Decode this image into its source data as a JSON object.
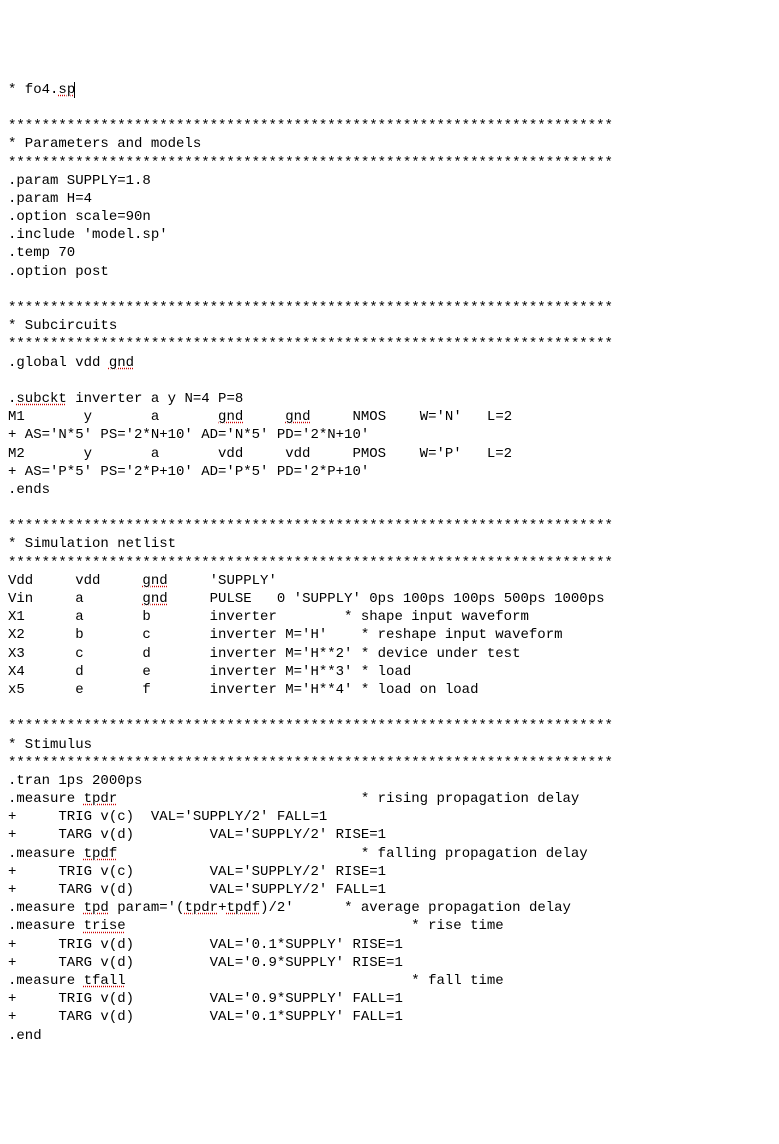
{
  "lines": {
    "l01a": "* fo4.",
    "l01b": "sp",
    "l02": "",
    "l03": "************************************************************************",
    "l04": "* Parameters and models",
    "l05": "************************************************************************",
    "l06": ".param SUPPLY=1.8",
    "l07": ".param H=4",
    "l08": ".option scale=90n",
    "l09": ".include 'model.sp'",
    "l10": ".temp 70",
    "l11": ".option post",
    "l12": "",
    "l13": "************************************************************************",
    "l14": "* Subcircuits",
    "l15": "************************************************************************",
    "l16a": ".global vdd ",
    "l16b": "gnd",
    "l17": "",
    "l18a": ".",
    "l18b": "subckt",
    "l18c": " inverter a y N=4 P=8",
    "l19a": "M1       y       a       ",
    "l19b": "gnd",
    "l19c": "     ",
    "l19d": "gnd",
    "l19e": "     NMOS    W='N'   L=2",
    "l20": "+ AS='N*5' PS='2*N+10' AD='N*5' PD='2*N+10'",
    "l21": "M2       y       a       vdd     vdd     PMOS    W='P'   L=2",
    "l22": "+ AS='P*5' PS='2*P+10' AD='P*5' PD='2*P+10'",
    "l23": ".ends",
    "l24": "",
    "l25": "************************************************************************",
    "l26": "* Simulation netlist",
    "l27": "************************************************************************",
    "l28a": "Vdd     vdd     ",
    "l28b": "gnd",
    "l28c": "     'SUPPLY'",
    "l29a": "Vin     a       ",
    "l29b": "gnd",
    "l29c": "     PULSE   0 'SUPPLY' 0ps 100ps 100ps 500ps 1000ps",
    "l30": "X1      a       b       inverter        * shape input waveform",
    "l31": "X2      b       c       inverter M='H'    * reshape input waveform",
    "l32": "X3      c       d       inverter M='H**2' * device under test",
    "l33": "X4      d       e       inverter M='H**3' * load",
    "l34": "x5      e       f       inverter M='H**4' * load on load",
    "l35": "",
    "l36": "************************************************************************",
    "l37": "* Stimulus",
    "l38": "************************************************************************",
    "l39": ".tran 1ps 2000ps",
    "l40a": ".measure ",
    "l40b": "tpdr",
    "l40c": "                             * rising propagation delay",
    "l41": "+     TRIG v(c)  VAL='SUPPLY/2' FALL=1",
    "l42": "+     TARG v(d)         VAL='SUPPLY/2' RISE=1",
    "l43a": ".measure ",
    "l43b": "tpdf",
    "l43c": "                             * falling propagation delay",
    "l44": "+     TRIG v(c)         VAL='SUPPLY/2' RISE=1",
    "l45": "+     TARG v(d)         VAL='SUPPLY/2' FALL=1",
    "l46a": ".measure ",
    "l46b": "tpd",
    "l46c": " param='(",
    "l46d": "tpdr",
    "l46e": "+",
    "l46f": "tpdf",
    "l46g": ")/2'      * average propagation delay",
    "l47a": ".measure ",
    "l47b": "trise",
    "l47c": "                                  * rise time",
    "l48": "+     TRIG v(d)         VAL='0.1*SUPPLY' RISE=1",
    "l49": "+     TARG v(d)         VAL='0.9*SUPPLY' RISE=1",
    "l50a": ".measure ",
    "l50b": "tfall",
    "l50c": "                                  * fall time",
    "l51": "+     TRIG v(d)         VAL='0.9*SUPPLY' FALL=1",
    "l52": "+     TARG v(d)         VAL='0.1*SUPPLY' FALL=1",
    "l53": ".end"
  }
}
